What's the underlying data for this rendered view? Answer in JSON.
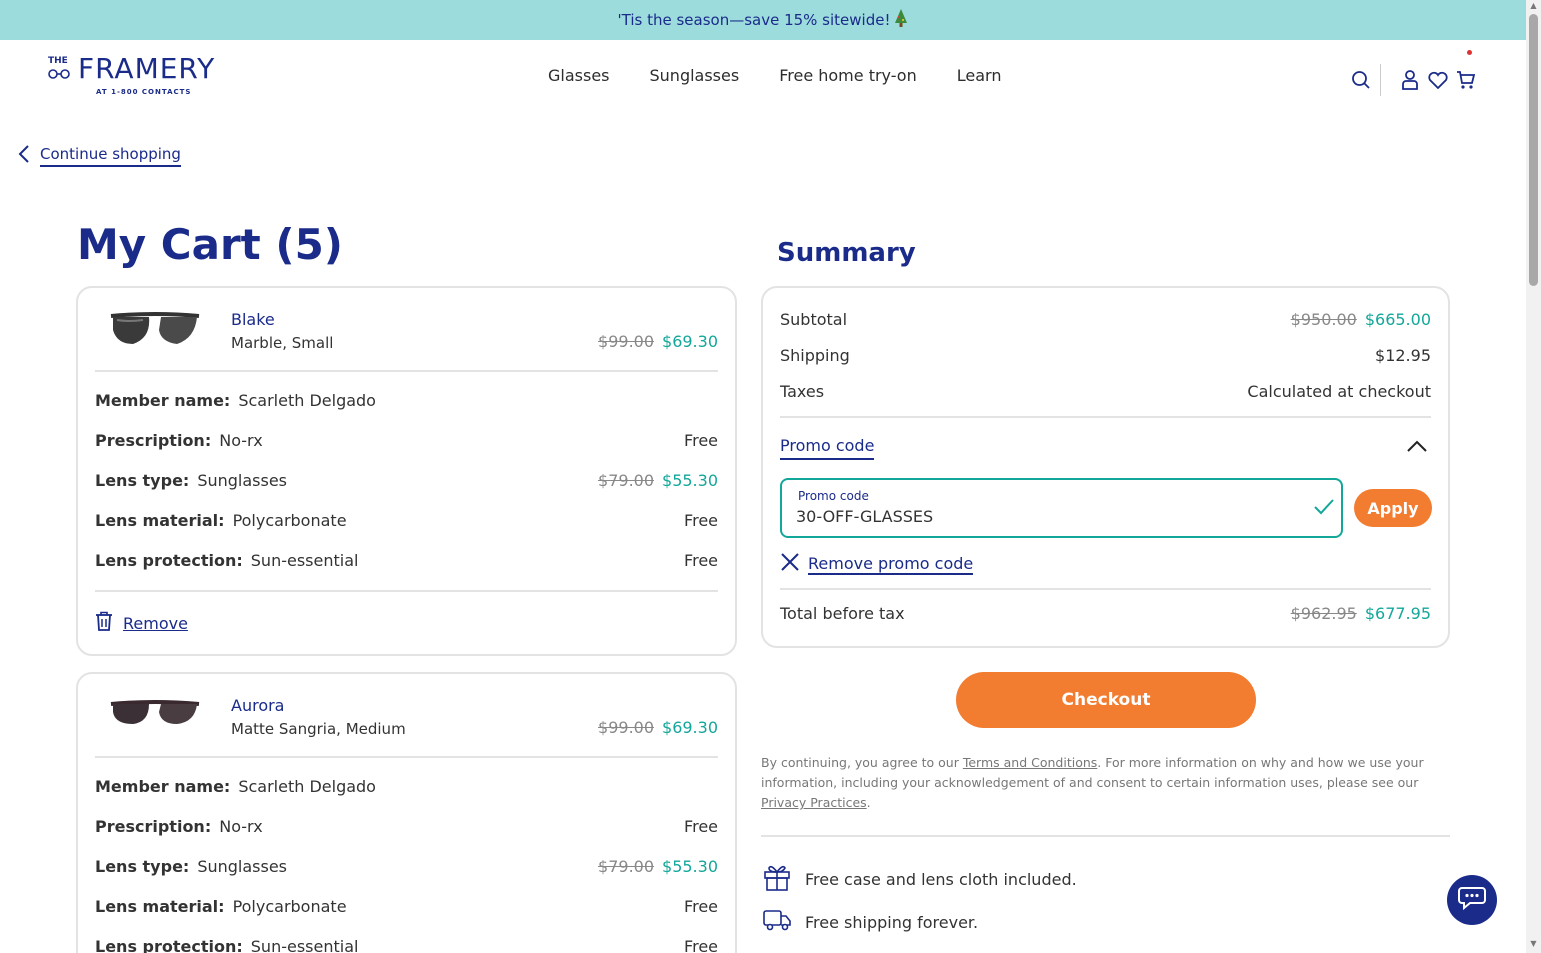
{
  "banner": {
    "text": "'Tis the season—save 15% sitewide!",
    "icon": "tree-icon"
  },
  "logo": {
    "the": "THE",
    "name": "FRAMERY",
    "sub": "AT 1-800 CONTACTS"
  },
  "nav": [
    "Glasses",
    "Sunglasses",
    "Free home try-on",
    "Learn"
  ],
  "continue_label": "Continue shopping",
  "cart_title": "My Cart (5)",
  "summary_title": "Summary",
  "items": [
    {
      "name": "Blake",
      "variant": "Marble, Small",
      "price_old": "$99.00",
      "price_new": "$69.30",
      "rows": [
        {
          "key": "Member name:",
          "value": "Scarleth Delgado",
          "right": ""
        },
        {
          "key": "Prescription:",
          "value": "No-rx",
          "right": "Free"
        },
        {
          "key": "Lens type:",
          "value": "Sunglasses",
          "right_old": "$79.00",
          "right_new": "$55.30"
        },
        {
          "key": "Lens material:",
          "value": "Polycarbonate",
          "right": "Free"
        },
        {
          "key": "Lens protection:",
          "value": "Sun-essential",
          "right": "Free"
        }
      ],
      "remove_label": "Remove"
    },
    {
      "name": "Aurora",
      "variant": "Matte Sangria, Medium",
      "price_old": "$99.00",
      "price_new": "$69.30",
      "rows": [
        {
          "key": "Member name:",
          "value": "Scarleth Delgado",
          "right": ""
        },
        {
          "key": "Prescription:",
          "value": "No-rx",
          "right": "Free"
        },
        {
          "key": "Lens type:",
          "value": "Sunglasses",
          "right_old": "$79.00",
          "right_new": "$55.30"
        },
        {
          "key": "Lens material:",
          "value": "Polycarbonate",
          "right": "Free"
        },
        {
          "key": "Lens protection:",
          "value": "Sun-essential",
          "right": "Free"
        }
      ]
    }
  ],
  "summary": {
    "subtotal_label": "Subtotal",
    "subtotal_old": "$950.00",
    "subtotal_new": "$665.00",
    "shipping_label": "Shipping",
    "shipping_value": "$12.95",
    "taxes_label": "Taxes",
    "taxes_value": "Calculated at checkout",
    "promo_label": "Promo code",
    "promo_field_label": "Promo code",
    "promo_value": "30-OFF-GLASSES",
    "apply_label": "Apply",
    "remove_promo_label": "Remove promo code",
    "total_label": "Total before tax",
    "total_old": "$962.95",
    "total_new": "$677.95"
  },
  "checkout_label": "Checkout",
  "legal": {
    "part1": "By continuing, you agree to our ",
    "terms": "Terms and Conditions",
    "part2": ". For more information on why and how we use your information, including your acknowledgement of and consent to certain information uses, please see our ",
    "privacy": "Privacy Practices",
    "part3": "."
  },
  "perks": [
    "Free case and lens cloth included.",
    "Free shipping forever."
  ],
  "colors": {
    "navy": "#1a2b8a",
    "teal": "#13a79a",
    "orange": "#f27c30",
    "banner": "#9ddcdc"
  }
}
